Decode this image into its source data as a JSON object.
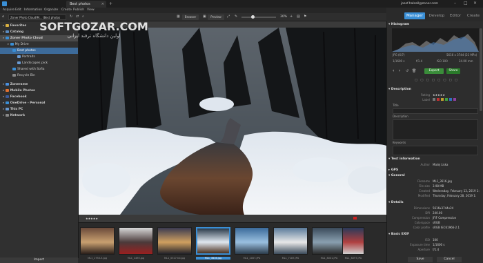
{
  "window": {
    "title": "Best photos",
    "account": "josef.halsall@zoner.com",
    "app_icon": "zoner-logo-icon"
  },
  "menu": [
    "Acquire",
    "Edit",
    "Information",
    "Organize",
    "Create",
    "Publish",
    "View"
  ],
  "toolbar": {
    "path": "Zoner Photo Cloud\\M... \\Best photos",
    "browser_label": "Browser",
    "preview_label": "Preview",
    "zoom": "30%"
  },
  "modes": [
    "Manager",
    "Develop",
    "Editor",
    "Create"
  ],
  "active_mode": "Manager",
  "watermark": {
    "line1": "SOFTGOZAR.COM",
    "line2": "اولین دانشگاه ترفند ایرانی"
  },
  "sidebar": {
    "items": [
      {
        "label": "Favorites",
        "indent": 0
      },
      {
        "label": "Catalog",
        "indent": 0
      },
      {
        "label": "Zoner Photo Cloud",
        "indent": 0
      },
      {
        "label": "My Drive",
        "indent": 1
      },
      {
        "label": "Best photos",
        "indent": 2,
        "selected": true
      },
      {
        "label": "Portraits",
        "indent": 3
      },
      {
        "label": "Landscapes pick",
        "indent": 3
      },
      {
        "label": "Shared with Sofia",
        "indent": 2
      },
      {
        "label": "Recycle Bin",
        "indent": 2
      },
      {
        "label": "Zonerame",
        "indent": 0
      },
      {
        "label": "Mobile Photos",
        "indent": 0
      },
      {
        "label": "Facebook",
        "indent": 0
      },
      {
        "label": "OneDrive - Personal",
        "indent": 0
      },
      {
        "label": "This PC",
        "indent": 0
      },
      {
        "label": "Network",
        "indent": 0
      }
    ],
    "import_label": "Import"
  },
  "filmstrip": {
    "thumbs": [
      {
        "caption": "ML1_1750-3.jpg",
        "colors": [
          "#6a4a3a",
          "#c9a070",
          "#2a1e1a"
        ]
      },
      {
        "caption": "ML1_1493.jpg",
        "colors": [
          "#d8d8d8",
          "#4a3a3a",
          "#9a2020"
        ]
      },
      {
        "caption": "ML1_0317.hd.jpg",
        "colors": [
          "#3a3a50",
          "#d0a060",
          "#202028"
        ]
      },
      {
        "caption": "ML1_3616.jpg",
        "colors": [
          "#2a3a4a",
          "#e0e8f0",
          "#4a3020"
        ],
        "selected": true
      },
      {
        "caption": "ML1_2007.JPG",
        "colors": [
          "#3a6a9a",
          "#9ac0e0",
          "#2a3a4a"
        ]
      },
      {
        "caption": "ML1_7187.JPG",
        "colors": [
          "#5a7a9a",
          "#e8e8e8",
          "#3a4a5a"
        ]
      },
      {
        "caption": "ML1_8001.JPG",
        "colors": [
          "#3a4a5a",
          "#8aa0b0",
          "#2a2a2a"
        ]
      },
      {
        "caption": "ML1_8097.JPG",
        "colors": [
          "#2a3a5a",
          "#b04040",
          "#d0d0d0"
        ]
      }
    ]
  },
  "right": {
    "histogram_label": "Histogram",
    "info_left": "JPG (6/7)",
    "info_right": "5616 x 3744 (21 MPx)",
    "exif_row": [
      "1/1600 s",
      "f/1.4",
      "ISO 100",
      "24.00 mm"
    ],
    "export_label": "Export",
    "share_label": "Share",
    "description_section": "Description",
    "rating_label": "Rating",
    "rating_value": "★★★★★",
    "label_label": "Label",
    "title_label": "Title",
    "description_label": "Description",
    "keywords_label": "Keywords",
    "text_info_section": "Text information",
    "author_label": "Author",
    "author_value": "Matej Liska",
    "gps_section": "GPS",
    "general_section": "General",
    "filename_label": "Filename",
    "filename_value": "ML1_3616.jpg",
    "filesize_label": "File size",
    "filesize_value": "3.98 MB",
    "created_label": "Created",
    "created_value": "Wednesday, February 13, 2019 1:",
    "modified_label": "Modified",
    "modified_value": "Thursday, February 28, 2019 1:",
    "details_section": "Details",
    "dimensions_label": "Dimensions",
    "dimensions_value": "5616x3744x24",
    "dpi_label": "DPI",
    "dpi_value": "240.00",
    "compression_label": "Compression",
    "compression_value": "JFIF Compression",
    "colorspace_label": "Colorspace",
    "colorspace_value": "sRGB",
    "colorprofile_label": "Color profile",
    "colorprofile_value": "sRGB IEC61966-2.1",
    "basic_exif_section": "Basic EXIF",
    "iso_label": "ISO",
    "iso_value": "100",
    "exposure_label": "Exposure time",
    "exposure_value": "1/1600 s",
    "aperture_label": "Aperture",
    "aperture_value": "f/1.4",
    "save_label": "Save",
    "cancel_label": "Cancel"
  },
  "colors": {
    "accent": "#3a8fd6",
    "export": "#3a8c3a",
    "share": "#2a7a2a",
    "selected": "#3d6b9a"
  }
}
